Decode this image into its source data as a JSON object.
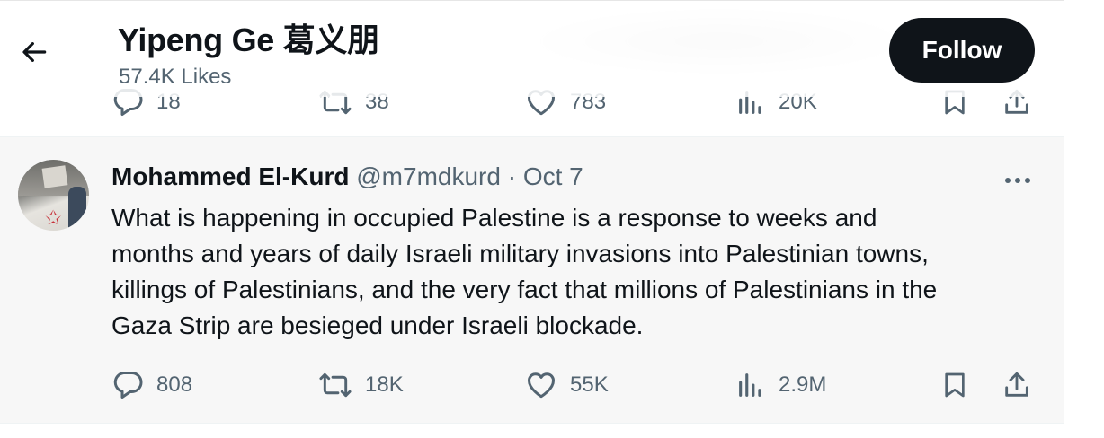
{
  "header": {
    "title": "Yipeng Ge 葛义朋",
    "subtitle": "57.4K Likes",
    "follow_label": "Follow"
  },
  "previous_tweet": {
    "replies": "18",
    "retweets": "38",
    "likes": "783",
    "views": "20K"
  },
  "tweet": {
    "author_name": "Mohammed El-Kurd",
    "handle": "@m7mdkurd",
    "separator": "·",
    "date": "Oct 7",
    "text_lines": [
      "What is happening in occupied Palestine is a response to weeks and",
      "months and years of daily Israeli military invasions into Palestinian towns,",
      "killings of Palestinians, and the very fact that millions of Palestinians in the",
      "Gaza Strip are besieged under Israeli blockade."
    ],
    "replies": "808",
    "retweets": "18K",
    "likes": "55K",
    "views": "2.9M"
  },
  "icons": {
    "back": "arrow-left-icon",
    "more": "more-horizontal-icon",
    "reply": "reply-icon",
    "retweet": "retweet-icon",
    "like": "heart-icon",
    "views": "views-chart-icon",
    "bookmark": "bookmark-icon",
    "share": "share-icon"
  },
  "colors": {
    "text_primary": "#0f1419",
    "text_secondary": "#536471",
    "follow_bg": "#0f1419",
    "tweet_hover_bg": "#f7f7f7"
  }
}
